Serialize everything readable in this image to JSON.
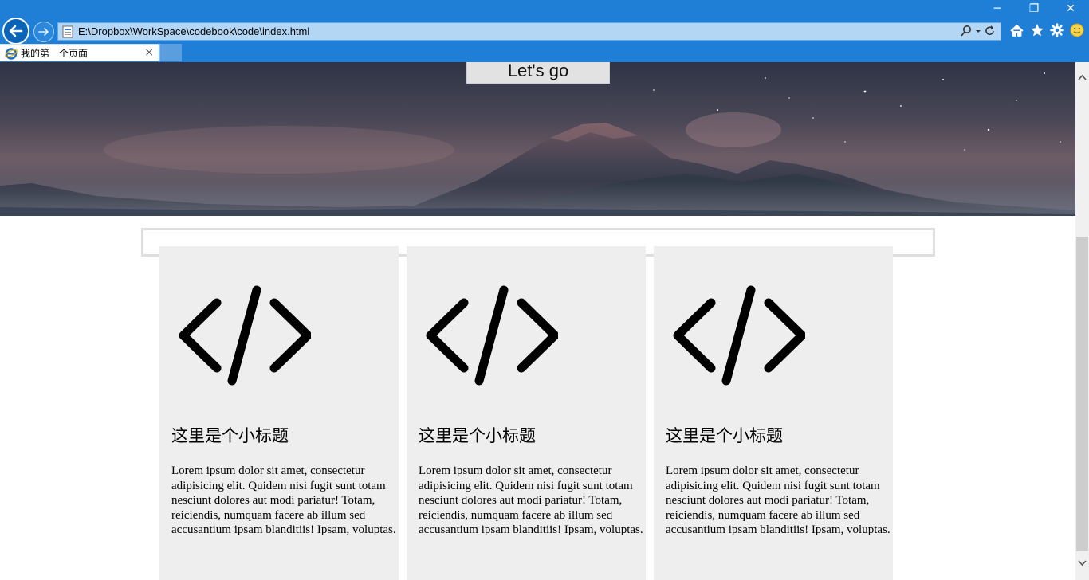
{
  "browser": {
    "address_url": "E:\\Dropbox\\WorkSpace\\codebook\\code\\index.html",
    "tab_title": "我的第一个页面",
    "tab_close": "×",
    "window_minimize": "─",
    "window_restore": "❐",
    "window_close": "✕",
    "colors": {
      "chrome": "#1f7fd6",
      "address_bg": "#b4d6f5"
    }
  },
  "hero": {
    "button_label": "Let's go"
  },
  "cards": [
    {
      "icon": "code-icon",
      "title": "这里是个小标题",
      "text": "Lorem ipsum dolor sit amet, consectetur adipisicing elit. Quidem nisi fugit sunt totam nesciunt dolores aut modi pariatur! Totam, reiciendis, numquam facere ab illum sed accusantium ipsam blanditiis! Ipsam, voluptas."
    },
    {
      "icon": "code-icon",
      "title": "这里是个小标题",
      "text": "Lorem ipsum dolor sit amet, consectetur adipisicing elit. Quidem nisi fugit sunt totam nesciunt dolores aut modi pariatur! Totam, reiciendis, numquam facere ab illum sed accusantium ipsam blanditiis! Ipsam, voluptas."
    },
    {
      "icon": "code-icon",
      "title": "这里是个小标题",
      "text": "Lorem ipsum dolor sit amet, consectetur adipisicing elit. Quidem nisi fugit sunt totam nesciunt dolores aut modi pariatur! Totam, reiciendis, numquam facere ab illum sed accusantium ipsam blanditiis! Ipsam, voluptas."
    }
  ]
}
